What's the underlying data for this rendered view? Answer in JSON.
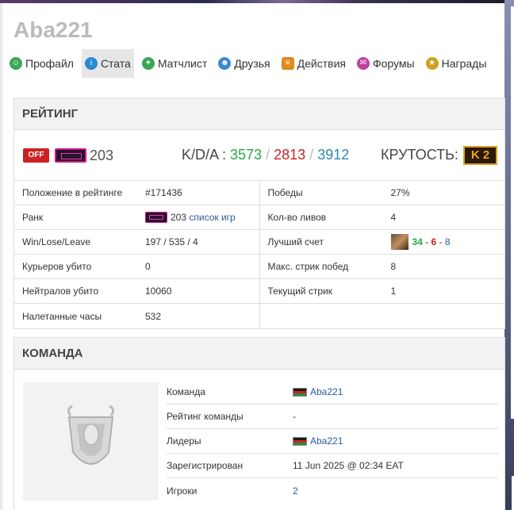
{
  "profile": {
    "name": "Aba221"
  },
  "nav": {
    "items": [
      {
        "label": "Профайл",
        "icon": "profile-icon",
        "color": "#3aa655"
      },
      {
        "label": "Стата",
        "icon": "stats-icon",
        "color": "#2a8ad0"
      },
      {
        "label": "Матчлист",
        "icon": "matchlist-icon",
        "color": "#3aa655"
      },
      {
        "label": "Друзья",
        "icon": "friends-icon",
        "color": "#3a8ad0"
      },
      {
        "label": "Действия",
        "icon": "actions-icon",
        "color": "#e08a20"
      },
      {
        "label": "Форумы",
        "icon": "forums-icon",
        "color": "#c040a0"
      },
      {
        "label": "Награды",
        "icon": "awards-icon",
        "color": "#d0a020"
      }
    ],
    "active": "Стата"
  },
  "rating": {
    "header": "РЕЙТИНГ",
    "status": "OFF",
    "rank_value": "203",
    "kda_label": "K/D/A :",
    "kills": "3573",
    "deaths": "2813",
    "assists": "3912",
    "kda_sep": "/",
    "krutost_label": "КРУТОСТЬ:",
    "krutost_badge": "K 2",
    "left_rows": [
      {
        "label": "Положение в рейтинге",
        "value": "#171436"
      },
      {
        "label": "Ранк",
        "value": "203",
        "link": "список игр"
      },
      {
        "label": "Win/Lose/Leave",
        "value": "197 / 535 / 4"
      },
      {
        "label": "Курьеров убито",
        "value": "0"
      },
      {
        "label": "Нейтралов убито",
        "value": "10060"
      },
      {
        "label": "Налетанные часы",
        "value": "532"
      }
    ],
    "right_rows": [
      {
        "label": "Победы",
        "value": "27%"
      },
      {
        "label": "Кол-во ливов",
        "value": "4"
      },
      {
        "label": "Лучший счет",
        "k": "34",
        "d": "6",
        "a": "8",
        "dash": "-"
      },
      {
        "label": "Макс. стрик побед",
        "value": "8"
      },
      {
        "label": "Текущий стрик",
        "value": "1"
      }
    ]
  },
  "team": {
    "header": "КОМАНДА",
    "rows": [
      {
        "label": "Команда",
        "value": "Aba221"
      },
      {
        "label": "Рейтинг команды",
        "value": "-"
      },
      {
        "label": "Лидеры",
        "value": "Aba221"
      },
      {
        "label": "Зарегистрирован",
        "value": "11 Jun 2025 @ 02:34 EAT"
      },
      {
        "label": "Игроки",
        "value": "2"
      }
    ]
  }
}
